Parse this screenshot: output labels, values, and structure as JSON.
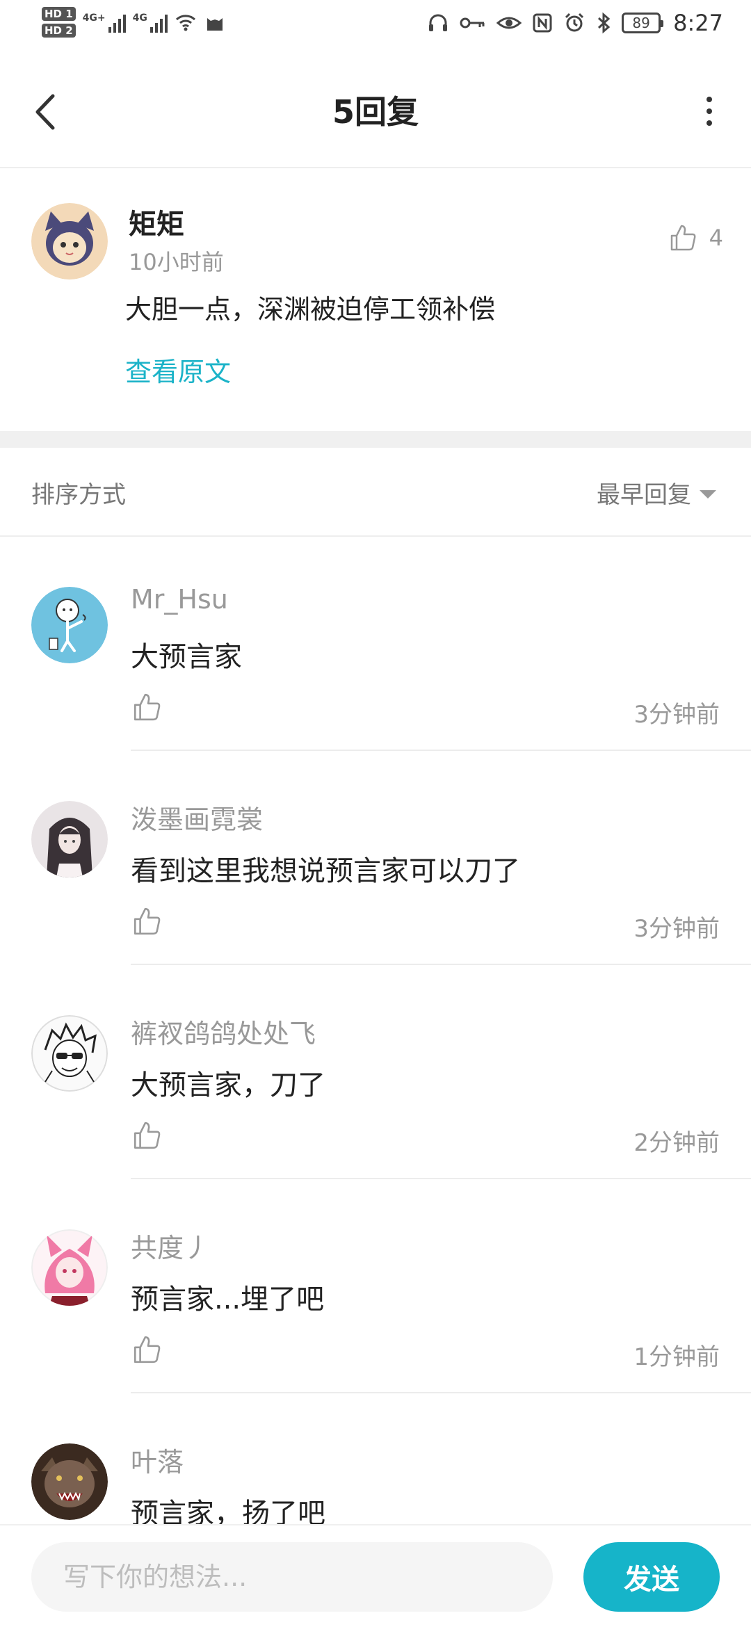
{
  "status_bar": {
    "hd1": "HD 1",
    "hd2": "HD 2",
    "net1": "4G+",
    "net2": "4G",
    "battery": "89",
    "time": "8:27",
    "icons": [
      "headphones-icon",
      "key-icon",
      "eye-icon",
      "nfc-icon",
      "alarm-icon",
      "bluetooth-icon"
    ]
  },
  "nav": {
    "title": "5回复"
  },
  "original_comment": {
    "author": "矩矩",
    "time": "10小时前",
    "text": "大胆一点，深渊被迫停工领补偿",
    "like_count": "4",
    "view_original": "查看原文"
  },
  "sort": {
    "label": "排序方式",
    "selected": "最早回复"
  },
  "replies": [
    {
      "name": "Mr_Hsu",
      "text": "大预言家",
      "time": "3分钟前"
    },
    {
      "name": "泼墨画霓裳",
      "text": "看到这里我想说预言家可以刀了",
      "time": "3分钟前"
    },
    {
      "name": "裤衩鸽鸽处处飞",
      "text": "大预言家，刀了",
      "time": "2分钟前"
    },
    {
      "name": "共度丿",
      "text": "预言家...埋了吧",
      "time": "1分钟前"
    },
    {
      "name": "叶落",
      "text": "预言家，扬了吧",
      "time": ""
    }
  ],
  "composer": {
    "placeholder": "写下你的想法...",
    "send_label": "发送"
  },
  "colors": {
    "accent": "#16b4c9",
    "link": "#1bb3c8"
  }
}
